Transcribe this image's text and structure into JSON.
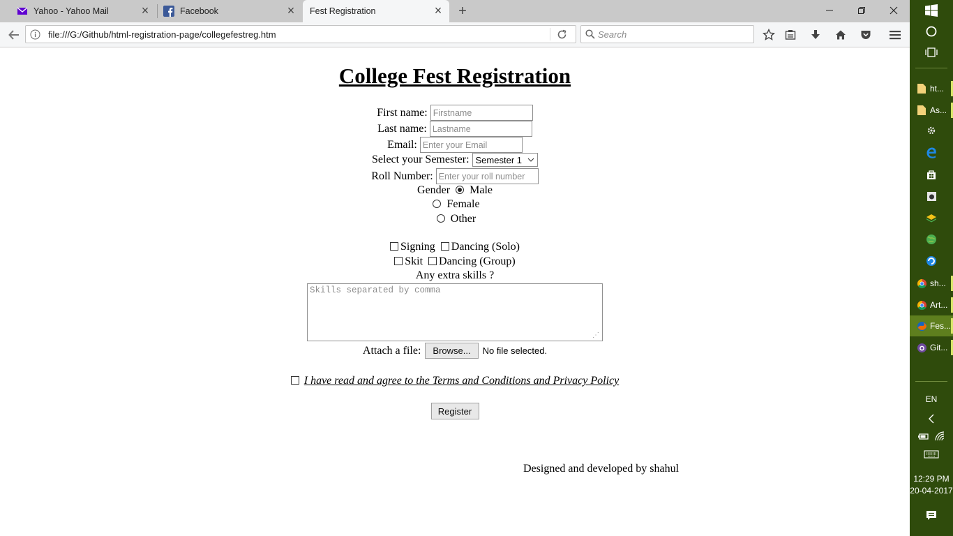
{
  "browser": {
    "tabs": [
      {
        "title": "Yahoo - Yahoo Mail",
        "icon": "yahoo-mail-icon",
        "active": false
      },
      {
        "title": "Facebook",
        "icon": "facebook-icon",
        "active": false
      },
      {
        "title": "Fest Registration",
        "icon": "none",
        "active": true
      }
    ],
    "url": "file:///G:/Github/html-registration-page/collegefestreg.htm",
    "search_placeholder": "Search"
  },
  "page": {
    "title": "College Fest Registration",
    "first_name": {
      "label": "First name:",
      "placeholder": "Firstname"
    },
    "last_name": {
      "label": "Last name:",
      "placeholder": "Lastname"
    },
    "email": {
      "label": "Email:",
      "placeholder": "Enter your Email"
    },
    "semester": {
      "label": "Select your Semester:",
      "selected": "Semester 1"
    },
    "roll": {
      "label": "Roll Number:",
      "placeholder": "Enter your roll number"
    },
    "gender": {
      "label": "Gender",
      "options": [
        "Male",
        "Female",
        "Other"
      ],
      "selected": "Male"
    },
    "events": [
      "Signing",
      "Dancing (Solo)",
      "Skit",
      "Dancing (Group)"
    ],
    "skills": {
      "label": "Any extra skills ?",
      "placeholder": "Skills separated by comma"
    },
    "file": {
      "label": "Attach a file:",
      "button": "Browse...",
      "status": "No file selected."
    },
    "terms": "I have read and agree to the Terms and Conditions and Privacy Policy",
    "register": "Register",
    "footer": "Designed and developed by shahul"
  },
  "taskbar": {
    "items": [
      {
        "label": "ht...",
        "icon": "folder-icon"
      },
      {
        "label": "As...",
        "icon": "folder-icon"
      },
      {
        "label": "sh...",
        "icon": "chrome-icon"
      },
      {
        "label": "Art...",
        "icon": "chrome-icon"
      },
      {
        "label": "Fes...",
        "icon": "firefox-icon",
        "active": true
      },
      {
        "label": "Git...",
        "icon": "github-icon"
      }
    ],
    "language": "EN",
    "time": "12:29 PM",
    "date": "20-04-2017"
  }
}
